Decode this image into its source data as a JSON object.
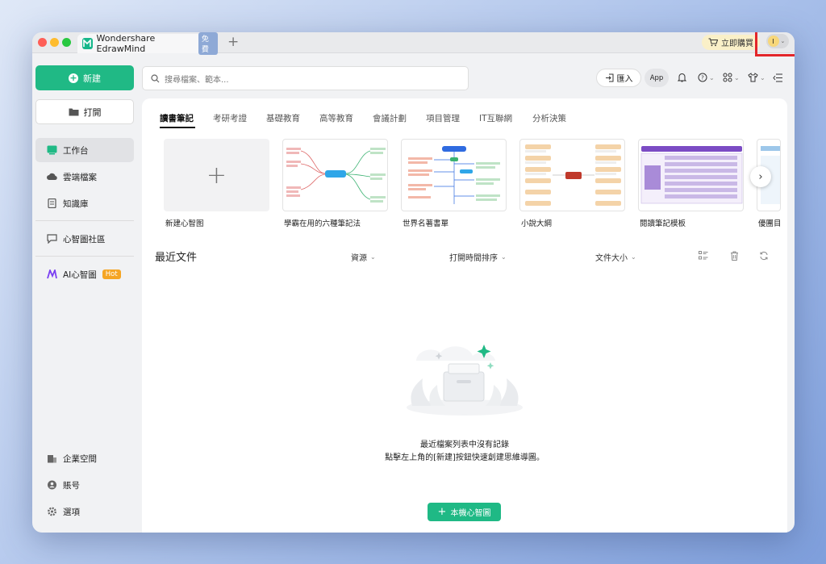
{
  "titlebar": {
    "tab_title": "Wondershare EdrawMind",
    "free_badge": "免費",
    "buy_label": "立即購買",
    "user_initial": "I"
  },
  "sidebar": {
    "new_label": "新建",
    "open_label": "打開",
    "items": [
      {
        "label": "工作台"
      },
      {
        "label": "雲端檔案"
      },
      {
        "label": "知識庫"
      },
      {
        "label": "心智圖社區"
      },
      {
        "label": "AI心智圖"
      }
    ],
    "hot_badge": "Hot",
    "bottom_items": [
      {
        "label": "企業空間"
      },
      {
        "label": "賬号"
      },
      {
        "label": "選項"
      }
    ]
  },
  "toolbar": {
    "search_placeholder": "搜尋檔案、範本...",
    "import_label": "匯入",
    "app_label": "App"
  },
  "categories": [
    "讀書筆記",
    "考研考證",
    "基礎教育",
    "高等教育",
    "會議計劃",
    "項目管理",
    "IT互聯網",
    "分析決策"
  ],
  "templates": [
    {
      "label": "新建心智图"
    },
    {
      "label": "學霸在用的六種筆記法"
    },
    {
      "label": "世界名著書單"
    },
    {
      "label": "小說大綱"
    },
    {
      "label": "閱讀筆記模板"
    },
    {
      "label": "優團目"
    }
  ],
  "recent": {
    "title": "最近文件",
    "col_source": "資源",
    "col_time": "打開時間排序",
    "col_size": "文件大小",
    "empty_line1": "最近檔案列表中沒有記錄",
    "empty_line2": "點擊左上角的[新建]按鈕快速創建思維導圖。",
    "local_button": "本機心智圖"
  },
  "colors": {
    "accent": "#20b985",
    "highlight_box": "#e3262a"
  }
}
